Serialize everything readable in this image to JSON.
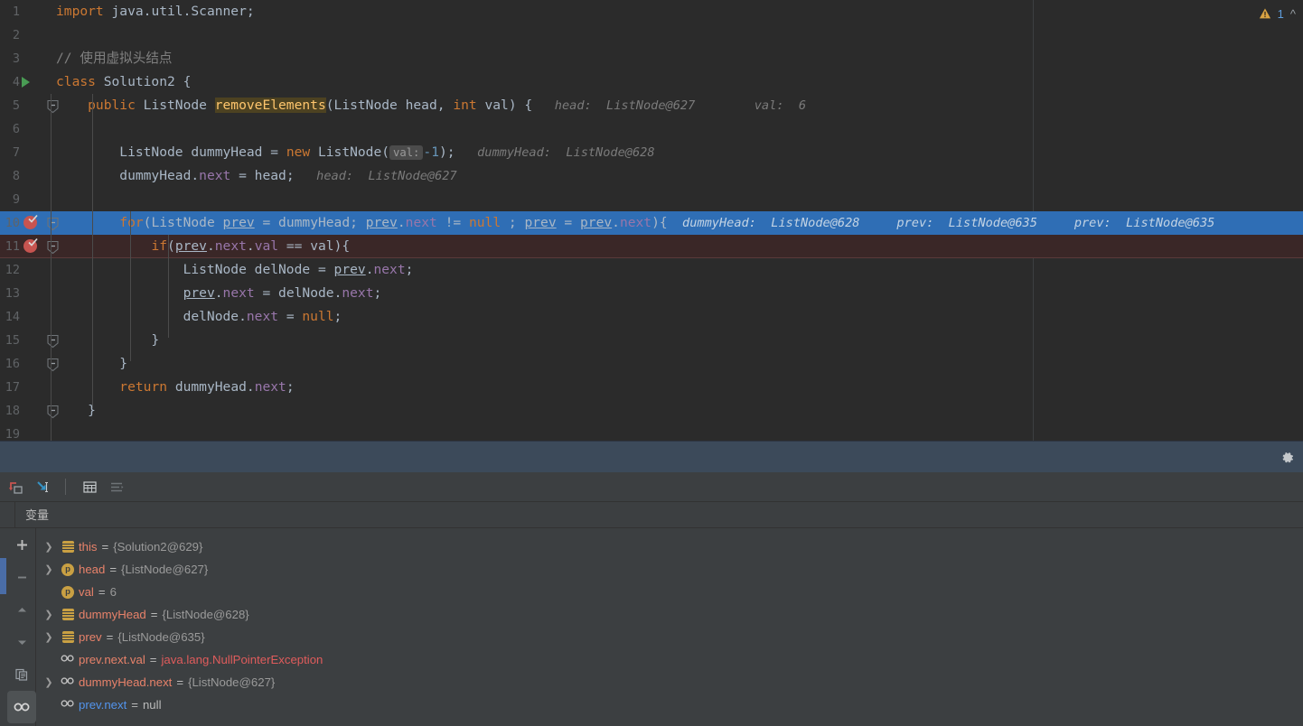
{
  "editor": {
    "warning_count": "1",
    "warning_icon": "warning-triangle-icon",
    "collapse_icon": "chevron-up-icon",
    "lines": [
      {
        "n": "1",
        "segments": [
          {
            "t": "import ",
            "c": "kw"
          },
          {
            "t": "java.util.Scanner;",
            "c": "plain"
          }
        ]
      },
      {
        "n": "2",
        "segments": []
      },
      {
        "n": "3",
        "segments": [
          {
            "t": "// 使用虚拟头结点",
            "c": "cmt"
          }
        ]
      },
      {
        "n": "4",
        "segments": [
          {
            "t": "class ",
            "c": "kw"
          },
          {
            "t": "Solution2 {",
            "c": "plain"
          }
        ]
      },
      {
        "n": "5",
        "segments": [
          {
            "t": "    public ",
            "c": "kw"
          },
          {
            "t": "ListNode ",
            "c": "cls"
          },
          {
            "t": "removeElements",
            "c": "hl-fn"
          },
          {
            "t": "(ListNode head, ",
            "c": "plain"
          },
          {
            "t": "int",
            "c": "kw"
          },
          {
            "t": " val) {",
            "c": "plain"
          }
        ]
      },
      {
        "n": "6",
        "segments": []
      },
      {
        "n": "7",
        "segments": [
          {
            "t": "        ListNode dummyHead = ",
            "c": "plain"
          },
          {
            "t": "new ",
            "c": "kw"
          },
          {
            "t": "ListNode(",
            "c": "plain"
          }
        ]
      },
      {
        "n": "8",
        "segments": [
          {
            "t": "        dummyHead.",
            "c": "plain"
          },
          {
            "t": "next",
            "c": "fld"
          },
          {
            "t": " = head;",
            "c": "plain"
          }
        ]
      },
      {
        "n": "9",
        "segments": []
      },
      {
        "n": "10",
        "segments": [
          {
            "t": "        ",
            "c": "plain"
          },
          {
            "t": "for",
            "c": "kw"
          },
          {
            "t": "(ListNode ",
            "c": "plain"
          },
          {
            "t": "prev",
            "c": "localvar"
          },
          {
            "t": " = dummyHead; ",
            "c": "plain"
          },
          {
            "t": "prev",
            "c": "localvar"
          },
          {
            "t": ".",
            "c": "plain"
          },
          {
            "t": "next",
            "c": "fld"
          },
          {
            "t": " != ",
            "c": "plain"
          },
          {
            "t": "null",
            "c": "kw"
          },
          {
            "t": " ; ",
            "c": "plain"
          },
          {
            "t": "prev",
            "c": "localvar"
          },
          {
            "t": " = ",
            "c": "plain"
          },
          {
            "t": "prev",
            "c": "localvar"
          },
          {
            "t": ".",
            "c": "plain"
          },
          {
            "t": "next",
            "c": "fld"
          },
          {
            "t": "){",
            "c": "plain"
          }
        ]
      },
      {
        "n": "11",
        "segments": [
          {
            "t": "            ",
            "c": "plain"
          },
          {
            "t": "if",
            "c": "kw"
          },
          {
            "t": "(",
            "c": "plain"
          },
          {
            "t": "prev",
            "c": "localvar"
          },
          {
            "t": ".",
            "c": "plain"
          },
          {
            "t": "next",
            "c": "fld"
          },
          {
            "t": ".",
            "c": "plain"
          },
          {
            "t": "val",
            "c": "fld"
          },
          {
            "t": " == val){",
            "c": "plain"
          }
        ]
      },
      {
        "n": "12",
        "segments": [
          {
            "t": "                ListNode delNode = ",
            "c": "plain"
          },
          {
            "t": "prev",
            "c": "localvar"
          },
          {
            "t": ".",
            "c": "plain"
          },
          {
            "t": "next",
            "c": "fld"
          },
          {
            "t": ";",
            "c": "plain"
          }
        ]
      },
      {
        "n": "13",
        "segments": [
          {
            "t": "                ",
            "c": "plain"
          },
          {
            "t": "prev",
            "c": "localvar"
          },
          {
            "t": ".",
            "c": "plain"
          },
          {
            "t": "next",
            "c": "fld"
          },
          {
            "t": " = delNode.",
            "c": "plain"
          },
          {
            "t": "next",
            "c": "fld"
          },
          {
            "t": ";",
            "c": "plain"
          }
        ]
      },
      {
        "n": "14",
        "segments": [
          {
            "t": "                delNode.",
            "c": "plain"
          },
          {
            "t": "next",
            "c": "fld"
          },
          {
            "t": " = ",
            "c": "plain"
          },
          {
            "t": "null",
            "c": "kw"
          },
          {
            "t": ";",
            "c": "plain"
          }
        ]
      },
      {
        "n": "15",
        "segments": [
          {
            "t": "            }",
            "c": "plain"
          }
        ]
      },
      {
        "n": "16",
        "segments": [
          {
            "t": "        }",
            "c": "plain"
          }
        ]
      },
      {
        "n": "17",
        "segments": [
          {
            "t": "        ",
            "c": "plain"
          },
          {
            "t": "return ",
            "c": "kw"
          },
          {
            "t": "dummyHead.",
            "c": "plain"
          },
          {
            "t": "next",
            "c": "fld"
          },
          {
            "t": ";",
            "c": "plain"
          }
        ]
      },
      {
        "n": "18",
        "segments": [
          {
            "t": "    }",
            "c": "plain"
          }
        ]
      },
      {
        "n": "19",
        "segments": []
      }
    ],
    "inline_hints": {
      "line5": "head:  ListNode@627        val:  6",
      "line7_inlay": "val:",
      "line7_rest": "-1);",
      "line7_hint": "dummyHead:  ListNode@628",
      "line8_hint": "head:  ListNode@627",
      "line10_hint_a": "dummyHead:  ListNode@628",
      "line10_hint_b": "prev:  ListNode@635",
      "line10_hint_c": "prev:  ListNode@635"
    }
  },
  "status_strip": {
    "settings_icon": "gear-icon"
  },
  "debug": {
    "toolbar": [
      {
        "name": "force-step-into-icon",
        "glyph": "force-step-into"
      },
      {
        "name": "run-to-cursor-icon",
        "glyph": "run-to-cursor"
      },
      {
        "name": "show-as-table-icon",
        "glyph": "table"
      },
      {
        "name": "sort-values-icon",
        "glyph": "sort"
      }
    ],
    "tabs": [
      {
        "label": "变量",
        "name": "tab-variables",
        "active": true
      }
    ],
    "rail": [
      {
        "name": "add-watch-button",
        "glyph": "plus",
        "active": false
      },
      {
        "name": "remove-watch-button",
        "glyph": "minus",
        "active": false
      },
      {
        "name": "move-watch-up-button",
        "glyph": "caret-up",
        "active": false
      },
      {
        "name": "move-watch-down-button",
        "glyph": "caret-down",
        "active": false
      },
      {
        "name": "copy-value-button",
        "glyph": "copy",
        "active": false
      },
      {
        "name": "watches-toggle-button",
        "glyph": "glasses",
        "active": true
      }
    ],
    "variables": [
      {
        "expandable": true,
        "icon": "object-icon",
        "icon_kind": "obj",
        "name": "this",
        "value": "{Solution2@629}",
        "value_kind": "ref",
        "name_color": "red"
      },
      {
        "expandable": true,
        "icon": "param-icon",
        "icon_kind": "param",
        "name": "head",
        "value": "{ListNode@627}",
        "value_kind": "ref",
        "name_color": "red"
      },
      {
        "expandable": false,
        "icon": "param-icon",
        "icon_kind": "param",
        "name": "val",
        "value": "6",
        "value_kind": "ref",
        "name_color": "red"
      },
      {
        "expandable": true,
        "icon": "object-icon",
        "icon_kind": "obj",
        "name": "dummyHead",
        "value": "{ListNode@628}",
        "value_kind": "ref",
        "name_color": "red"
      },
      {
        "expandable": true,
        "icon": "object-icon",
        "icon_kind": "obj",
        "name": "prev",
        "value": "{ListNode@635}",
        "value_kind": "ref",
        "name_color": "red"
      },
      {
        "expandable": false,
        "icon": "watch-icon",
        "icon_kind": "watch",
        "name": "prev.next.val",
        "value": "java.lang.NullPointerException",
        "value_kind": "err",
        "name_color": "red"
      },
      {
        "expandable": true,
        "icon": "watch-icon",
        "icon_kind": "watch",
        "name": "dummyHead.next",
        "value": "{ListNode@627}",
        "value_kind": "ref",
        "name_color": "red"
      },
      {
        "expandable": false,
        "icon": "watch-icon",
        "icon_kind": "watch",
        "name": "prev.next",
        "value": "null",
        "value_kind": "nul",
        "name_color": "blue"
      }
    ]
  },
  "colors": {
    "editor_bg": "#2b2b2b",
    "panel_bg": "#3c3f41",
    "exec_line": "#2f6eb5",
    "error_line": "#3a2727",
    "status_strip": "#3c4a5a",
    "accent_blue": "#4a6da7",
    "breakpoint_red": "#c75450",
    "keyword_orange": "#cc7832",
    "field_purple": "#9876aa",
    "method_yellow": "#ffc66d",
    "error_red": "#e05c5c"
  }
}
